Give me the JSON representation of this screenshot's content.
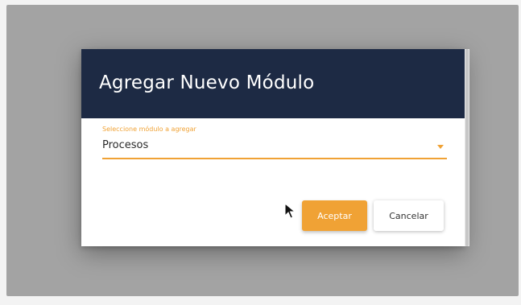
{
  "dialog": {
    "title": "Agregar Nuevo Módulo",
    "module_select": {
      "label": "Seleccione módulo a agregar",
      "value": "Procesos"
    },
    "buttons": {
      "accept_label": "Aceptar",
      "cancel_label": "Cancelar"
    }
  },
  "colors": {
    "header_bg": "#1d2a44",
    "accent": "#f0a235",
    "overlay": "#a3a3a3"
  },
  "icons": {
    "dropdown": "chevron-down-icon",
    "cursor": "mouse-pointer-icon"
  }
}
